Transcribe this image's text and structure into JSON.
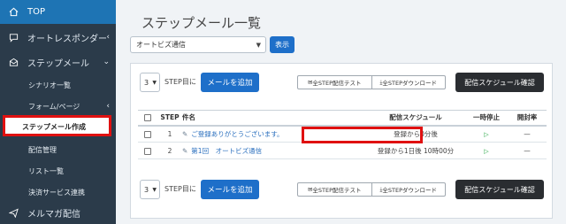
{
  "sidebar": {
    "items": [
      {
        "label": "TOP",
        "icon": "home-icon"
      },
      {
        "label": "オートレスポンダー",
        "icon": "chat-icon"
      },
      {
        "label": "ステップメール",
        "icon": "mail-icon"
      },
      {
        "label": "メルマガ配信",
        "icon": "send-icon"
      }
    ],
    "sub_items": [
      {
        "label": "シナリオ一覧"
      },
      {
        "label": "フォーム/ページ"
      },
      {
        "label": "ステップメール作成"
      },
      {
        "label": "配信管理"
      },
      {
        "label": "リスト一覧"
      },
      {
        "label": "決済サービス連携"
      }
    ]
  },
  "main": {
    "title": "ステップメール一覧",
    "scenario_select": "オートビズ通信",
    "show_button": "表示"
  },
  "controls": {
    "step_value": "3",
    "step_suffix": "STEP目に",
    "add_mail": "メールを追加",
    "test_all": "全STEP配信テスト",
    "download_all": "全STEPダウンロード",
    "schedule_confirm": "配信スケジュール確認"
  },
  "table": {
    "headers": {
      "step": "STEP",
      "subject": "件名",
      "schedule": "配信スケジュール",
      "pause": "一時停止",
      "open_rate": "開封率"
    },
    "rows": [
      {
        "step": "1",
        "subject": "ご登録ありがとうございます。",
        "schedule": "登録から0分後",
        "pause": "▷",
        "open_rate": "—"
      },
      {
        "step": "2",
        "subject": "第1回　オートビズ通信",
        "schedule": "登録から1日後 10時00分",
        "pause": "▷",
        "open_rate": "—"
      }
    ]
  },
  "colors": {
    "sidebar": "#2b3b4a",
    "active": "#1e74b4",
    "primary_button": "#1e6fc9",
    "dark_button": "#2a2d31",
    "highlight": "#e01010"
  }
}
